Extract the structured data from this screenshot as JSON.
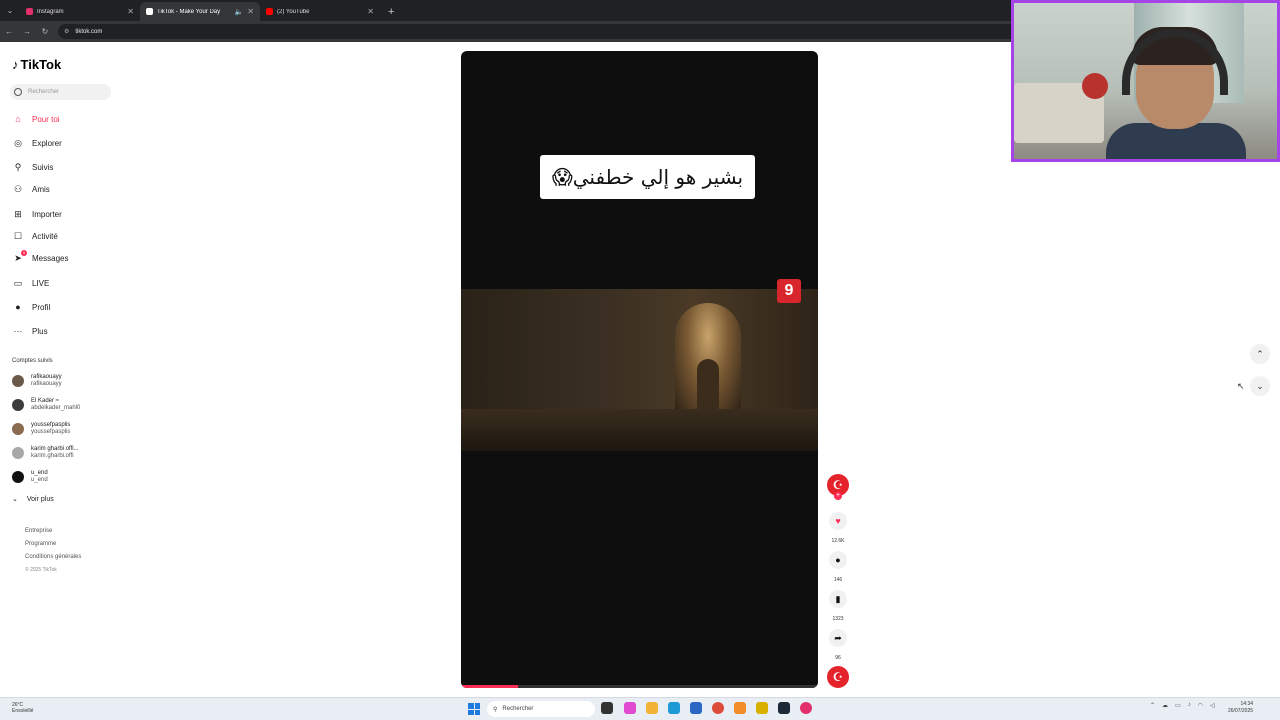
{
  "browser": {
    "tabs": [
      {
        "title": "Instagram",
        "favicon_color": "#e1306c",
        "active": false
      },
      {
        "title": "TikTok - Make Your Day",
        "favicon_color": "#ffffff",
        "active": true
      },
      {
        "title": "(2) YouTube",
        "favicon_color": "#ff0000",
        "active": false
      }
    ],
    "url": "tiktok.com"
  },
  "tiktok": {
    "logo_text": "TikTok",
    "search_placeholder": "Rechercher",
    "nav": [
      {
        "label": "Pour toi",
        "icon": "home-icon",
        "active": true
      },
      {
        "label": "Explorer",
        "icon": "compass-icon"
      },
      {
        "label": "Suivis",
        "icon": "following-icon"
      },
      {
        "label": "Amis",
        "icon": "friends-icon"
      },
      {
        "label": "Importer",
        "icon": "upload-icon"
      },
      {
        "label": "Activité",
        "icon": "activity-icon"
      },
      {
        "label": "Messages",
        "icon": "messages-icon",
        "badge": "9"
      },
      {
        "label": "LIVE",
        "icon": "live-icon"
      },
      {
        "label": "Profil",
        "icon": "profile-icon"
      },
      {
        "label": "Plus",
        "icon": "more-icon"
      }
    ],
    "followed_title": "Comptes suivis",
    "followed": [
      {
        "name": "rafikaouayy",
        "handle": "rafikaouayy"
      },
      {
        "name": "El Kader ≈",
        "handle": "abdelkader_mahl0"
      },
      {
        "name": "youssefpasplis",
        "handle": "youssefpasplis"
      },
      {
        "name": "karim gharbi offi...",
        "handle": "karim.gharbi.offi"
      },
      {
        "name": "u_end",
        "handle": "u_end"
      }
    ],
    "see_more": "Voir plus",
    "footer_links": [
      "Entreprise",
      "Programme",
      "Conditions générales"
    ],
    "copyright": "© 2025 TikTok",
    "video": {
      "caption": "بشير هو إلي خطفني😱",
      "channel_badge": "9",
      "progress": 0.16
    },
    "actions": {
      "likes": "12.6K",
      "comments": "146",
      "saves": "1323",
      "shares": "96"
    }
  },
  "taskbar": {
    "weather_temp": "26°C",
    "weather_desc": "Ensoleillé",
    "search_label": "Rechercher",
    "time": "14:34",
    "date": "26/07/2025"
  }
}
